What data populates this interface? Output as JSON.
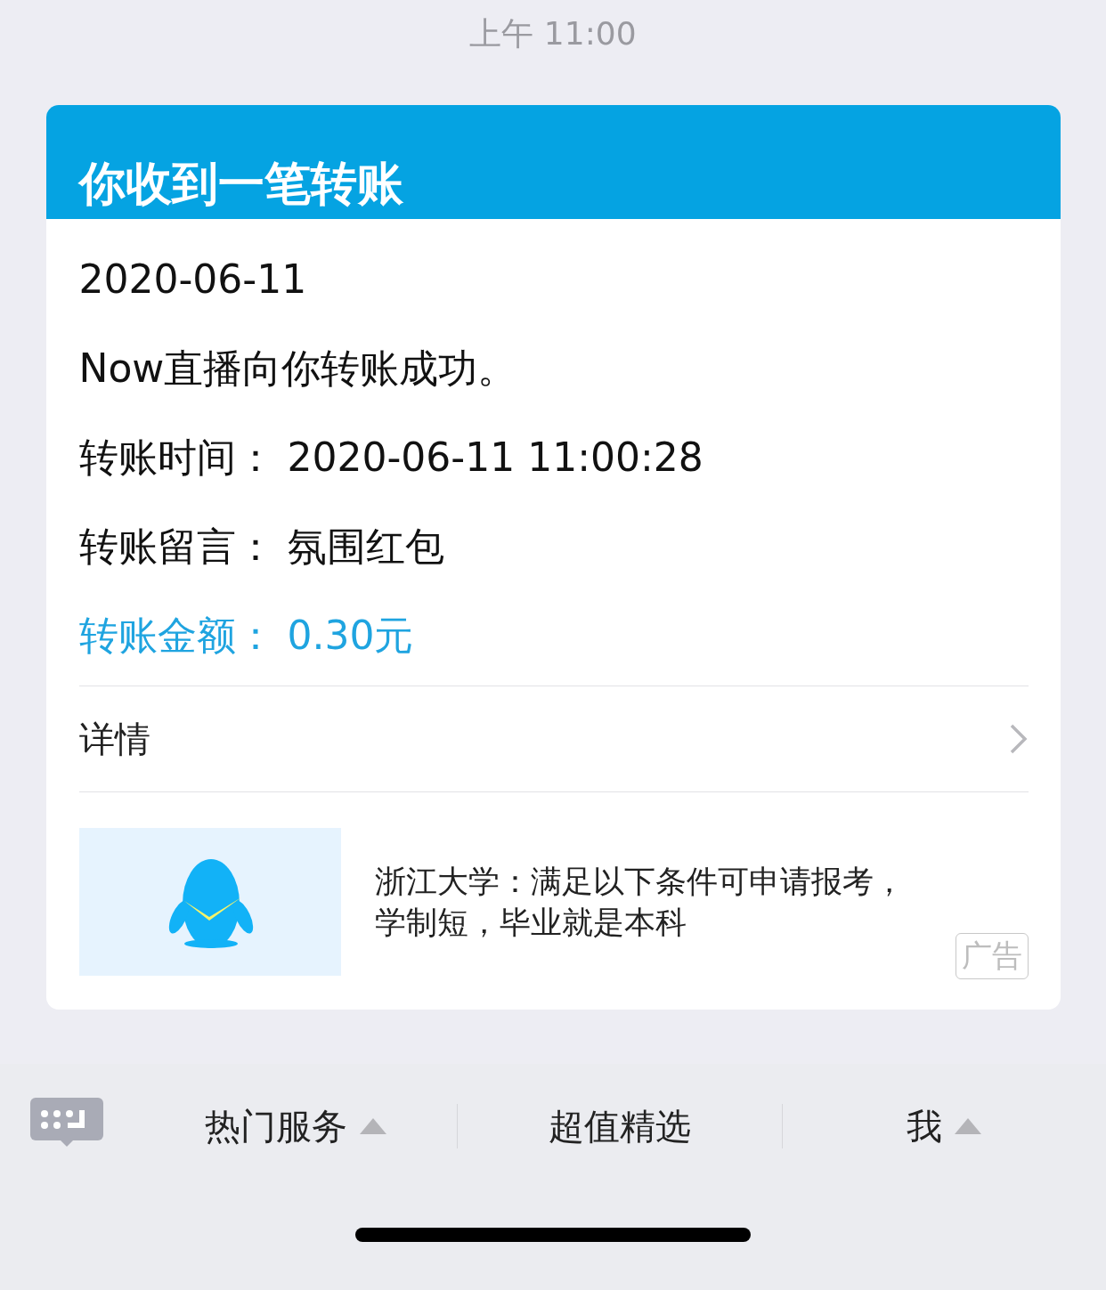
{
  "timestamp": "上午 11:00",
  "card": {
    "title": "你收到一笔转账",
    "date": "2020-06-11",
    "message": "Now直播向你转账成功。",
    "fields": [
      {
        "kind": "plain",
        "label": "转账时间：",
        "value": "2020-06-11 11:00:28"
      },
      {
        "kind": "plain",
        "label": "转账留言：",
        "value": "氛围红包"
      },
      {
        "kind": "highlight",
        "label": "转账金额：",
        "value": "0.30元"
      }
    ],
    "details_link": "详情",
    "ad": {
      "kind": "picture",
      "text": "浙江大学：满足以下条件可申请报考，学制短，毕业就是本科",
      "badge": "广告"
    }
  },
  "menu": [
    {
      "label": "热门服务",
      "has_submenu": true
    },
    {
      "label": "超值精选",
      "has_submenu": false
    },
    {
      "label": "我",
      "has_submenu": true
    }
  ]
}
